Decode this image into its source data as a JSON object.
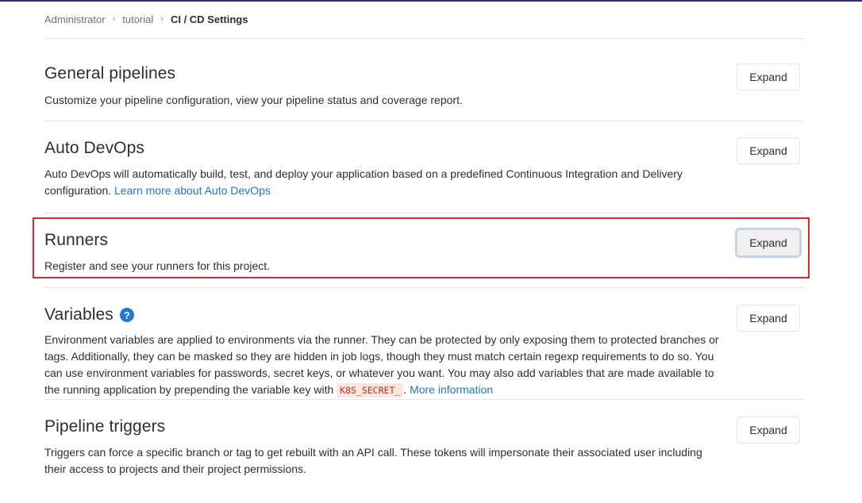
{
  "breadcrumb": {
    "items": [
      "Administrator",
      "tutorial"
    ],
    "current": "CI / CD Settings"
  },
  "sections": {
    "general": {
      "title": "General pipelines",
      "description": "Customize your pipeline configuration, view your pipeline status and coverage report.",
      "button": "Expand"
    },
    "autodevops": {
      "title": "Auto DevOps",
      "description": "Auto DevOps will automatically build, test, and deploy your application based on a predefined Continuous Integration and Delivery configuration.",
      "link": "Learn more about Auto DevOps",
      "button": "Expand"
    },
    "runners": {
      "title": "Runners",
      "description": "Register and see your runners for this project.",
      "button": "Expand"
    },
    "variables": {
      "title": "Variables",
      "help_icon": "question-circle-icon",
      "help_glyph": "?",
      "description": "Environment variables are applied to environments via the runner. They can be protected by only exposing them to protected branches or tags. Additionally, they can be masked so they are hidden in job logs, though they must match certain regexp requirements to do so. You can use environment variables for passwords, secret keys, or whatever you want. You may also add variables that are made available to the running application by prepending the variable key with",
      "code": "K8S_SECRET_",
      "suffix": ".",
      "link": "More information",
      "button": "Expand"
    },
    "triggers": {
      "title": "Pipeline triggers",
      "description": "Triggers can force a specific branch or tag to get rebuilt with an API call. These tokens will impersonate their associated user including their access to projects and their project permissions.",
      "button": "Expand"
    }
  },
  "colors": {
    "link": "#1f78d1",
    "highlight": "#e0282e",
    "code_text": "#c0341d",
    "code_bg": "#fbe5e1"
  }
}
